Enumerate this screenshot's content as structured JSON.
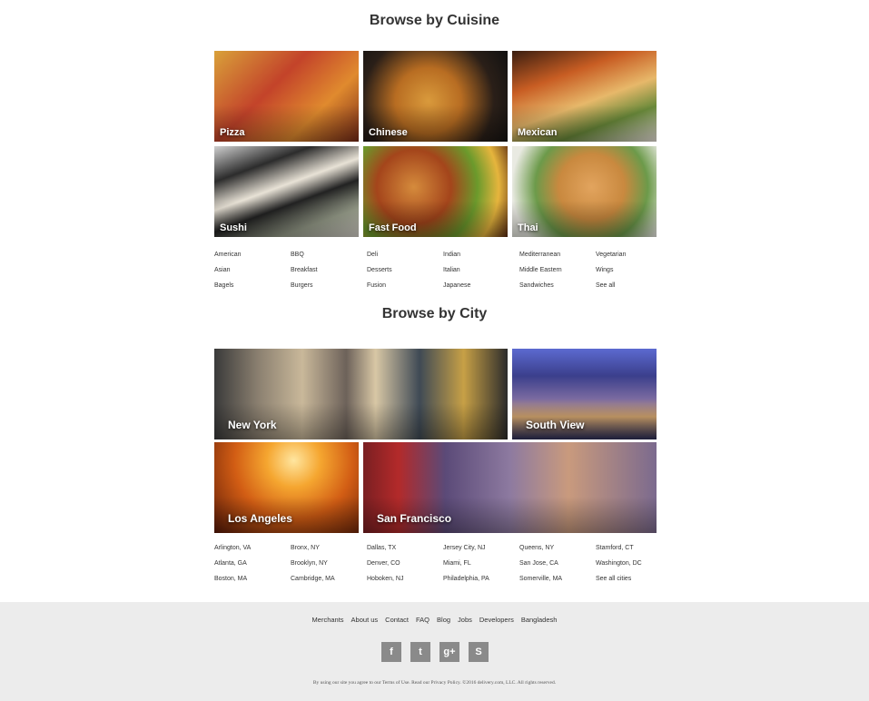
{
  "cuisine": {
    "title": "Browse by Cuisine",
    "tiles": [
      {
        "label": "Pizza"
      },
      {
        "label": "Chinese"
      },
      {
        "label": "Mexican"
      },
      {
        "label": "Sushi"
      },
      {
        "label": "Fast Food"
      },
      {
        "label": "Thai"
      }
    ],
    "links": [
      "American",
      "BBQ",
      "Deli",
      "Indian",
      "Mediterranean",
      "Vegetarian",
      "Asian",
      "Breakfast",
      "Desserts",
      "Italian",
      "Middle Eastern",
      "Wings",
      "Bagels",
      "Burgers",
      "Fusion",
      "Japanese",
      "Sandwiches",
      "See all"
    ]
  },
  "city": {
    "title": "Browse by City",
    "tiles": [
      {
        "label": "New York"
      },
      {
        "label": "South View"
      },
      {
        "label": "Los Angeles"
      },
      {
        "label": "San Francisco"
      }
    ],
    "links": [
      "Arlington, VA",
      "Bronx, NY",
      "Dallas, TX",
      "Jersey City, NJ",
      "Queens, NY",
      "Stamford, CT",
      "Atlanta, GA",
      "Brooklyn, NY",
      "Denver, CO",
      "Miami, FL",
      "San Jose, CA",
      "Washington, DC",
      "Boston, MA",
      "Cambridge, MA",
      "Hoboken, NJ",
      "Philadelphia, PA",
      "Somerville, MA",
      "See all cities"
    ]
  },
  "footer": {
    "nav": [
      "Merchants",
      "About us",
      "Contact",
      "FAQ",
      "Blog",
      "Jobs",
      "Developers",
      "Bangladesh"
    ],
    "social": [
      {
        "icon": "facebook-icon",
        "glyph": "f"
      },
      {
        "icon": "twitter-icon",
        "glyph": "t"
      },
      {
        "icon": "google-plus-icon",
        "glyph": "g+"
      },
      {
        "icon": "skype-icon",
        "glyph": "S"
      }
    ],
    "legal": "By using our site you agree to our Terms of Use. Read our Privacy Policy. ©2016 delivery.com, LLC. All rights reserved."
  },
  "colors": {
    "footer_bg": "#ececec",
    "social_bg": "#8a8a8a"
  }
}
